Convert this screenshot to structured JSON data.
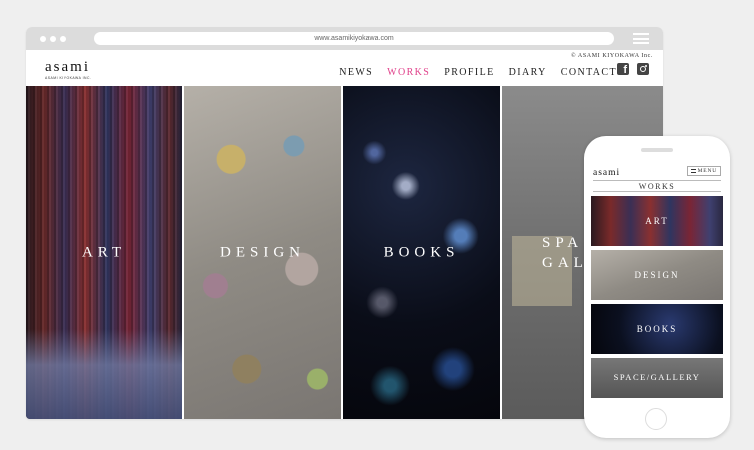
{
  "browser": {
    "url": "www.asamikiyokawa.com"
  },
  "site": {
    "logo_text": "asami",
    "logo_subtext": "ASAMI KIYOKAWA INC.",
    "copyright": "© ASAMI KIYOKAWA Inc.",
    "accent_color": "#e0408a",
    "nav": [
      {
        "label": "NEWS",
        "active": false
      },
      {
        "label": "WORKS",
        "active": true
      },
      {
        "label": "PROFILE",
        "active": false
      },
      {
        "label": "DIARY",
        "active": false
      },
      {
        "label": "CONTACT",
        "active": false
      }
    ],
    "social": [
      "facebook-icon",
      "instagram-icon"
    ]
  },
  "panels": [
    {
      "id": "art",
      "label": "ART"
    },
    {
      "id": "design",
      "label": "DESIGN"
    },
    {
      "id": "books",
      "label": "BOOKS"
    },
    {
      "id": "space",
      "label_line1": "SPA",
      "label_line2": "GALL"
    }
  ],
  "mobile": {
    "logo_text": "asami",
    "menu_label": "MENU",
    "section_title": "WORKS",
    "tiles": [
      "ART",
      "DESIGN",
      "BOOKS",
      "SPACE/GALLERY"
    ]
  }
}
